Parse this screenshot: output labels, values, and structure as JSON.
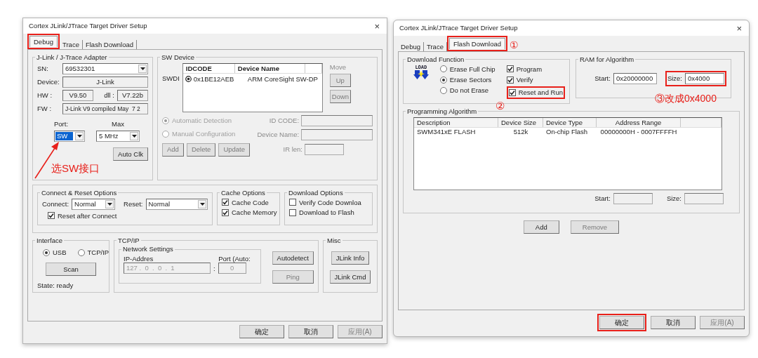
{
  "debug_dialog": {
    "title": "Cortex JLink/JTrace Target Driver Setup",
    "close": "×",
    "tabs": [
      {
        "label": "Debug",
        "selected": true,
        "highlighted": true
      },
      {
        "label": "Trace",
        "selected": false,
        "highlighted": false
      },
      {
        "label": "Flash Download",
        "selected": false,
        "highlighted": false
      }
    ],
    "adapter": {
      "title": "J-Link / J-Trace Adapter",
      "sn_label": "SN:",
      "sn_value": "69532301",
      "device_label": "Device:",
      "device_value": "J-Link",
      "hw_label": "HW :",
      "hw_value": "V9.50",
      "dll_label": "dll :",
      "dll_value": "V7.22b",
      "fw_label": "FW :",
      "fw_value": "J-Link V9 compiled May  7 2",
      "port_label": "Port:",
      "port_value": "SW",
      "port_focused": true,
      "max_label": "Max",
      "max_value": "5 MHz",
      "auto_clk": "Auto Clk"
    },
    "annotation": "选SW接口",
    "sw_device": {
      "title": "SW Device",
      "swdi_label": "SWDI",
      "columns": [
        "IDCODE",
        "Device Name"
      ],
      "rows": [
        {
          "idcode": "0x1BE12AEB",
          "device_name": "ARM CoreSight SW-DP",
          "selected": true
        }
      ],
      "move_label": "Move",
      "move_buttons": [
        {
          "label": "Up",
          "disabled": true
        },
        {
          "label": "Down",
          "disabled": true
        }
      ],
      "modes": [
        {
          "label": "Automatic Detection",
          "selected": true,
          "disabled": true
        },
        {
          "label": "Manual Configuration",
          "selected": false,
          "disabled": true
        }
      ],
      "id_code_label": "ID CODE:",
      "device_name_label": "Device Name:",
      "ir_len_label": "IR len:",
      "buttons": [
        {
          "label": "Add",
          "disabled": true
        },
        {
          "label": "Delete",
          "disabled": true
        },
        {
          "label": "Update",
          "disabled": true
        }
      ]
    },
    "connect_reset": {
      "title": "Connect & Reset Options",
      "connect_label": "Connect:",
      "connect_value": "Normal",
      "reset_label": "Reset:",
      "reset_value": "Normal",
      "options": [
        {
          "label": "Reset after Connect",
          "checked": true
        }
      ]
    },
    "cache": {
      "title": "Cache Options",
      "options": [
        {
          "label": "Cache Code",
          "checked": true
        },
        {
          "label": "Cache Memory",
          "checked": true
        }
      ]
    },
    "download": {
      "title": "Download Options",
      "options": [
        {
          "label": "Verify Code Downloa",
          "checked": false
        },
        {
          "label": "Download to Flash",
          "checked": false
        }
      ]
    },
    "interface": {
      "title": "Interface",
      "modes": [
        {
          "label": "USB",
          "selected": true
        },
        {
          "label": "TCP/IP",
          "selected": false
        }
      ],
      "scan": "Scan",
      "state": "State: ready"
    },
    "tcpip": {
      "title": "TCP/IP",
      "network_title": "Network Settings",
      "ip_label": "IP-Addres",
      "port_label": "Port (Auto:",
      "ip_value": "127 .  0  .  0  .  1",
      "separator": ":",
      "port_value": "0",
      "buttons": [
        {
          "label": "Autodetect",
          "disabled": false
        },
        {
          "label": "Ping",
          "disabled": true
        }
      ]
    },
    "misc": {
      "title": "Misc",
      "buttons": [
        {
          "label": "JLink Info"
        },
        {
          "label": "JLink Cmd"
        }
      ]
    },
    "footer": [
      {
        "label": "确定",
        "disabled": false,
        "highlighted": false
      },
      {
        "label": "取消",
        "disabled": false,
        "highlighted": false
      },
      {
        "label": "应用(A)",
        "disabled": true,
        "highlighted": false
      }
    ]
  },
  "flash_dialog": {
    "title": "Cortex JLink/JTrace Target Driver Setup",
    "close": "×",
    "tabs": [
      {
        "label": "Debug",
        "selected": false,
        "highlighted": false
      },
      {
        "label": "Trace",
        "selected": false,
        "highlighted": false
      },
      {
        "label": "Flash Download",
        "selected": true,
        "highlighted": true
      }
    ],
    "tab_marker": "①",
    "download_function": {
      "title": "Download Function",
      "icon_text": "LOAD",
      "erase_modes": [
        {
          "label": "Erase Full Chip",
          "selected": false
        },
        {
          "label": "Erase Sectors",
          "selected": true
        },
        {
          "label": "Do not Erase",
          "selected": false
        }
      ],
      "options": [
        {
          "label": "Program",
          "checked": true,
          "highlighted": false
        },
        {
          "label": "Verify",
          "checked": true,
          "highlighted": false
        },
        {
          "label": "Reset and Run",
          "checked": true,
          "highlighted": true
        }
      ],
      "marker": "②"
    },
    "ram": {
      "title": "RAM for Algorithm",
      "start_label": "Start:",
      "start_value": "0x20000000",
      "size_label": "Size:",
      "size_value": "0x4000",
      "highlighted": true,
      "note": "③改成0x4000"
    },
    "algorithm": {
      "title": "Programming Algorithm",
      "columns": [
        "Description",
        "Device Size",
        "Device Type",
        "Address Range"
      ],
      "rows": [
        {
          "cells": [
            "SWM341xE FLASH",
            "512k",
            "On-chip Flash",
            "00000000H - 0007FFFFH"
          ]
        }
      ],
      "start_label": "Start:",
      "size_label": "Size:"
    },
    "buttons": [
      {
        "label": "Add",
        "disabled": false
      },
      {
        "label": "Remove",
        "disabled": true
      }
    ],
    "footer": [
      {
        "label": "确定",
        "disabled": false,
        "highlighted": true
      },
      {
        "label": "取消",
        "disabled": false,
        "highlighted": false
      },
      {
        "label": "应用(A)",
        "disabled": true,
        "highlighted": false
      }
    ]
  }
}
